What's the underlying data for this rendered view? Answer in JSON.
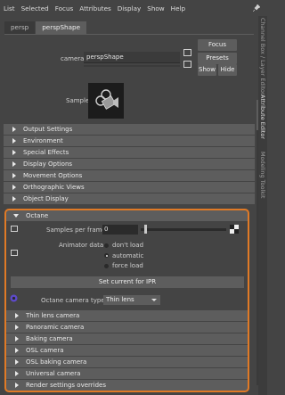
{
  "menu": [
    "List",
    "Selected",
    "Focus",
    "Attributes",
    "Display",
    "Show",
    "Help"
  ],
  "tabs": [
    "persp",
    "perspShape"
  ],
  "camera": {
    "label": "camera:",
    "value": "perspShape",
    "buttons": {
      "focus": "Focus",
      "presets": "Presets",
      "show": "Show",
      "hide": "Hide"
    }
  },
  "sample_label": "Sample",
  "sections": [
    "Output Settings",
    "Environment",
    "Special Effects",
    "Display Options",
    "Movement Options",
    "Orthographic Views",
    "Object Display"
  ],
  "octane": {
    "title": "Octane",
    "samples_label": "Samples per frame",
    "samples_value": "0",
    "animator_label": "Animator data",
    "animator_options": [
      "don't load",
      "automatic",
      "force load"
    ],
    "animator_selected_index": 1,
    "ipr_button": "Set current for IPR",
    "camera_type_label": "Octane camera type",
    "camera_type_value": "Thin lens",
    "subsections": [
      "Thin lens camera",
      "Panoramic camera",
      "Baking camera",
      "OSL camera",
      "OSL baking camera",
      "Universal camera",
      "Render settings overrides"
    ],
    "highlight_color": "#e07a26"
  },
  "side_tabs": [
    "Channel Box / Layer Editor",
    "Attribute Editor",
    "Modeling Toolkit"
  ]
}
